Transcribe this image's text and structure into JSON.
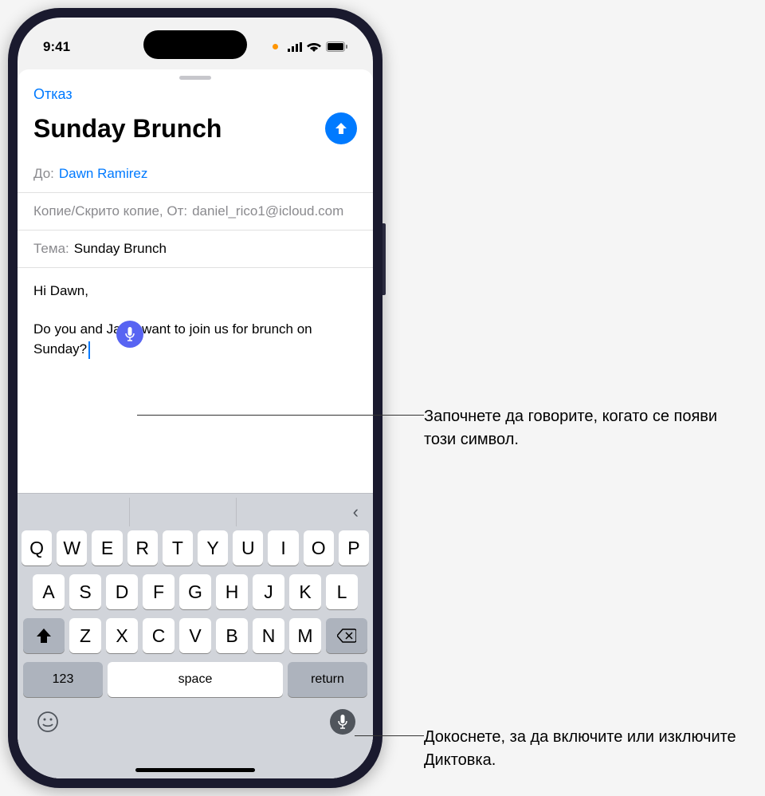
{
  "status": {
    "time": "9:41"
  },
  "compose": {
    "cancel": "Отказ",
    "title": "Sunday Brunch",
    "to_label": "До:",
    "to_value": "Dawn Ramirez",
    "cc_label": "Копие/Скрито копие, От:",
    "from_value": "daniel_rico1@icloud.com",
    "subject_label": "Тема:",
    "subject_value": "Sunday Brunch",
    "body_greeting": "Hi Dawn,",
    "body_text": "Do you and Jamil want to join us for brunch on Sunday?"
  },
  "keyboard": {
    "row1": [
      "Q",
      "W",
      "E",
      "R",
      "T",
      "Y",
      "U",
      "I",
      "O",
      "P"
    ],
    "row2": [
      "A",
      "S",
      "D",
      "F",
      "G",
      "H",
      "J",
      "K",
      "L"
    ],
    "row3": [
      "Z",
      "X",
      "C",
      "V",
      "B",
      "N",
      "M"
    ],
    "num": "123",
    "space": "space",
    "return": "return"
  },
  "callouts": {
    "c1": "Започнете да говорите, когато се появи този символ.",
    "c2": "Докоснете, за да включите или изключите Диктовка."
  }
}
